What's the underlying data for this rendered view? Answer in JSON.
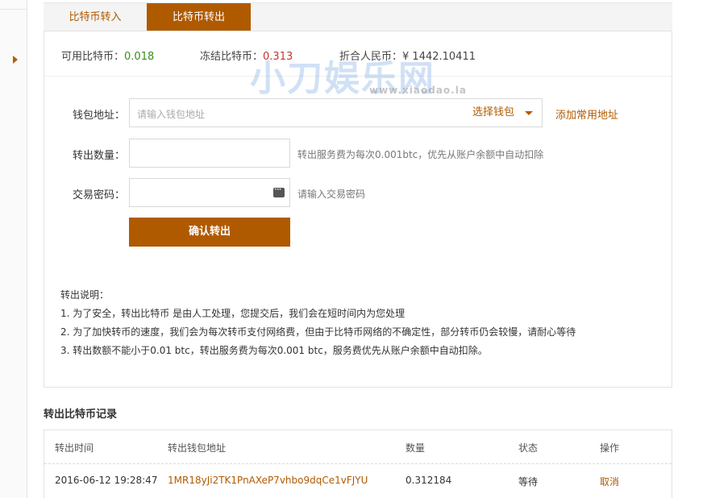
{
  "colors": {
    "accent": "#b05a00",
    "green": "#3d8b1f",
    "red": "#c0392b"
  },
  "tabs": [
    {
      "label": "比特币转入",
      "active": false
    },
    {
      "label": "比特币转出",
      "active": true
    }
  ],
  "balances": {
    "available_label": "可用比特币：",
    "available_value": "0.018",
    "frozen_label": "冻结比特币：",
    "frozen_value": "0.313",
    "rmb_label": "折合人民币：",
    "rmb_value": "¥ 1442.10411"
  },
  "watermark": {
    "url": "www.xiaodao.la"
  },
  "form": {
    "wallet_label": "钱包地址：",
    "wallet_placeholder": "请输入钱包地址",
    "select_wallet": "选择钱包",
    "add_address": "添加常用地址",
    "amount_label": "转出数量：",
    "amount_hint": "转出服务费为每次0.001btc，优先从账户余额中自动扣除",
    "password_label": "交易密码：",
    "password_hint": "请输入交易密码",
    "confirm_button": "确认转出",
    "password_icon": "keyboard-icon",
    "select_icon": "caret-down-icon"
  },
  "notes": {
    "title": "转出说明：",
    "items": [
      "1. 为了安全，转出比特币 是由人工处理，您提交后，我们会在短时间内为您处理",
      "2. 为了加快转币的速度，我们会为每次转币支付网络费，但由于比特币网络的不确定性，部分转币仍会较慢，请耐心等待",
      "3. 转出数额不能小于0.01 btc，转出服务费为每次0.001 btc，服务费优先从账户余额中自动扣除。"
    ]
  },
  "records": {
    "title": "转出比特币记录",
    "headers": [
      "转出时间",
      "转出钱包地址",
      "数量",
      "状态",
      "操作"
    ],
    "rows": [
      {
        "time": "2016-06-12 19:28:47",
        "address": "1MR18yJi2TK1PnAXeP7vhbo9dqCe1vFJYU",
        "amount": "0.312184",
        "status": "等待",
        "action": "取消"
      }
    ]
  }
}
